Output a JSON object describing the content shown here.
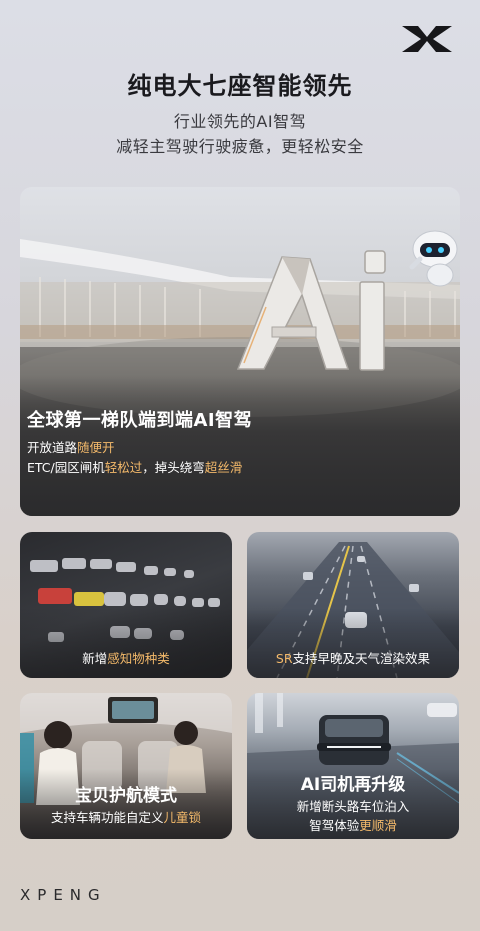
{
  "brand": {
    "logo_icon": "xpeng-x-logo-icon",
    "wordmark": "XPENG"
  },
  "header": {
    "headline": "纯电大七座智能领先",
    "subline1": "行业领先的AI智驾",
    "subline2": "减轻主驾驶行驶疲惫，更轻松安全"
  },
  "hero": {
    "title": "全球第一梯队端到端AI智驾",
    "line1_plain": "开放道路",
    "line1_accent": "随便开",
    "line2_a": "ETC/园区闸机",
    "line2_accent1": "轻松过",
    "line2_b": "，掉头绕弯",
    "line2_accent2": "超丝滑",
    "sculpture_text": "AI"
  },
  "cards": {
    "perception": {
      "plain": "新增",
      "accent": "感知物种类"
    },
    "sr": {
      "accent": "SR",
      "plain": "支持早晚及天气渲染效果"
    },
    "baby": {
      "title": "宝贝护航模式",
      "plain": "支持车辆功能自定义",
      "accent": "儿童锁"
    },
    "driver": {
      "title": "AI司机再升级",
      "line1": "新增断头路车位泊入",
      "line2_plain": "智驾体验",
      "line2_accent": "更顺滑"
    }
  },
  "colors": {
    "accent_gold": "#f3b96a",
    "text_dark": "#1a1a1e"
  }
}
